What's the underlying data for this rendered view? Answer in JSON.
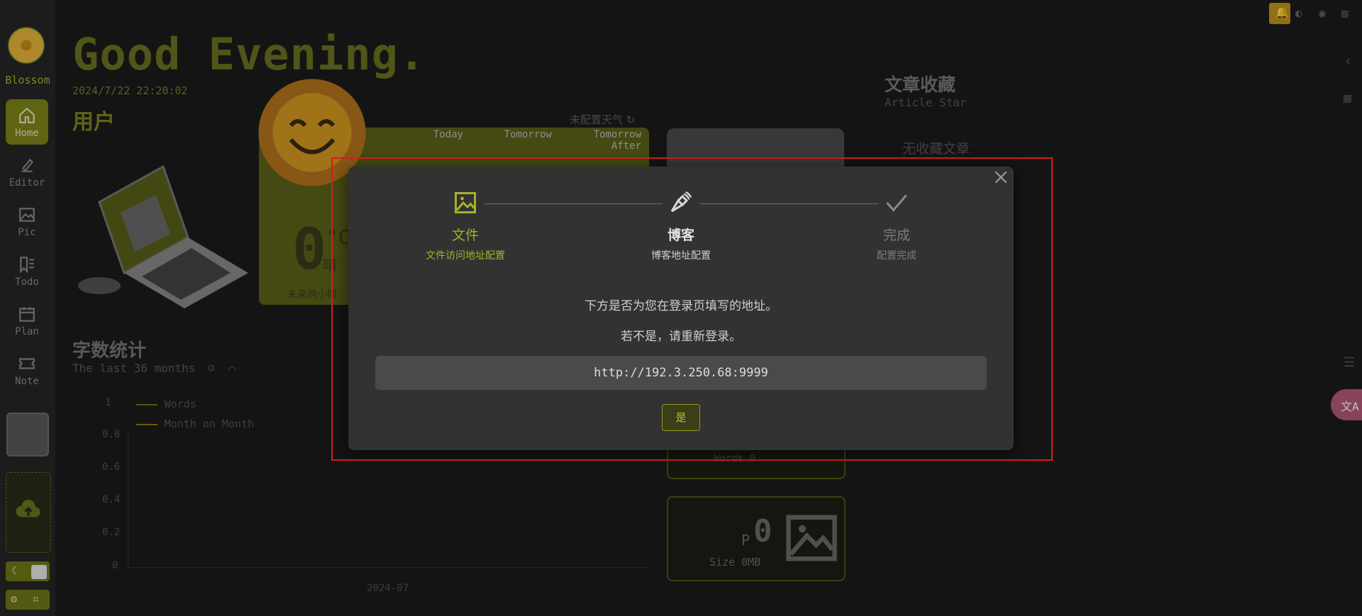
{
  "sidebar": {
    "app_name": "Blossom",
    "items": [
      {
        "label": "Home",
        "icon": "home-icon",
        "active": true
      },
      {
        "label": "Editor",
        "icon": "editor-icon"
      },
      {
        "label": "Pic",
        "icon": "picture-icon"
      },
      {
        "label": "Todo",
        "icon": "todo-icon"
      },
      {
        "label": "Plan",
        "icon": "calendar-icon"
      },
      {
        "label": "Note",
        "icon": "ticket-icon"
      }
    ]
  },
  "home": {
    "greeting": "Good Evening.",
    "datetime": "2024/7/22 22:20:02",
    "user_heading": "用户",
    "weather": {
      "unset_label": "未配置天气",
      "columns": [
        "Today",
        "Tomorrow",
        "Tomorrow After"
      ],
      "temp": "0",
      "unit": "°C",
      "condition": "晴",
      "next_two_hours": "未来两小时:"
    },
    "word_count": {
      "heading": "字数统计",
      "subtitle": "The last 36 months",
      "legend": [
        "Words",
        "Month on Month"
      ],
      "y_ticks": [
        "1",
        "0.8",
        "0.6",
        "0.4",
        "0.2",
        "0"
      ],
      "x_label": "2024-07"
    },
    "cards": {
      "words_label": "Words 0",
      "pic_prefix": "P",
      "pic_count": "0",
      "pic_size": "Size 0MB"
    },
    "articles": {
      "heading": "文章收藏",
      "subtitle": "Article Star",
      "empty": "无收藏文章"
    }
  },
  "dialog": {
    "steps": [
      {
        "title": "文件",
        "desc": "文件访问地址配置",
        "state": "done"
      },
      {
        "title": "博客",
        "desc": "博客地址配置",
        "state": "current"
      },
      {
        "title": "完成",
        "desc": "配置完成",
        "state": "pending"
      }
    ],
    "message1": "下方是否为您在登录页填写的地址。",
    "message2": "若不是，请重新登录。",
    "url": "http://192.3.250.68:9999",
    "confirm_label": "是"
  },
  "colors": {
    "accent": "#7e8617",
    "accent_text": "#a9b03a",
    "dialog_bg": "#323232",
    "highlight": "#d42020"
  }
}
